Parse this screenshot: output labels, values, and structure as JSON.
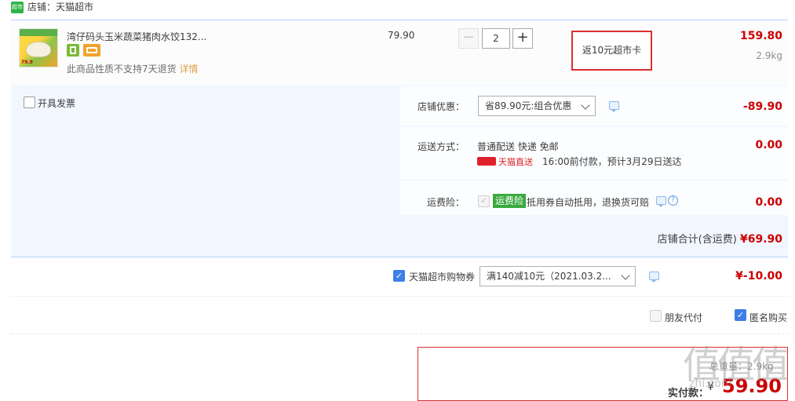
{
  "shop": {
    "logo_text": "超市",
    "label": "店铺：天猫超市"
  },
  "item": {
    "thumb_price": "79.9",
    "title": "湾仔码头玉米蔬菜猪肉水饺132...",
    "unit_price": "79.90",
    "quantity": "2",
    "qty_minus": "−",
    "qty_plus": "+",
    "rebate": "返10元超市卡",
    "subtotal": "159.80",
    "weight": "2.9kg",
    "no_return_text": "此商品性质不支持7天退货",
    "detail_link": "详情",
    "service_icons": [
      "receipt-icon",
      "card-icon"
    ]
  },
  "invoice": {
    "label": "开具发票"
  },
  "discount": {
    "label": "店铺优惠：",
    "selected": "省89.90元:组合优惠",
    "amount": "-89.90"
  },
  "shipping": {
    "label": "运送方式：",
    "method": "普通配送 快递 免邮",
    "direct_badge": "天猫直送",
    "eta": "16:00前付款，预计3月29日送达",
    "amount": "0.00"
  },
  "insurance": {
    "label": "运费险：",
    "badge": "运费险",
    "desc": "抵用券自动抵用，退换货可赔",
    "help": "?",
    "amount": "0.00"
  },
  "shop_total": {
    "label": "店铺合计(含运费)",
    "amount": "¥69.90"
  },
  "coupon": {
    "label": "天猫超市购物券",
    "selected": "满140减10元（2021.03.2...",
    "amount": "¥-10.00"
  },
  "options": {
    "friend_pay": "朋友代付",
    "anonymous": "匿名购买"
  },
  "payment": {
    "weight": "总重量：2.9kg",
    "label": "实付款：",
    "symbol": "¥",
    "amount": "59.90"
  },
  "watermark": {
    "text": "值值值",
    "sub": "zhi.com"
  },
  "colors": {
    "price_red": "#cc0000",
    "accent_blue": "#3d7ee8",
    "panel_blue": "#f2f7ff",
    "highlight_red": "#d9302f",
    "insurance_green": "#39a93e"
  }
}
